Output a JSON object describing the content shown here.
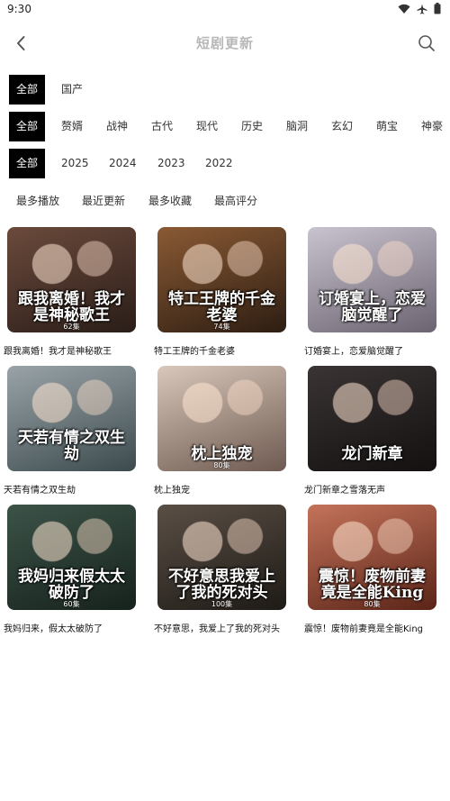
{
  "status": {
    "time": "9:30"
  },
  "header": {
    "title": "短剧更新"
  },
  "filters": {
    "region": [
      "全部",
      "国产"
    ],
    "genre": [
      "全部",
      "赘婿",
      "战神",
      "古代",
      "现代",
      "历史",
      "脑洞",
      "玄幻",
      "萌宝",
      "神豪"
    ],
    "year": [
      "全部",
      "2025",
      "2024",
      "2023",
      "2022"
    ]
  },
  "sort": [
    "最多播放",
    "最近更新",
    "最多收藏",
    "最高评分"
  ],
  "dramas": [
    {
      "title": "跟我离婚！我才是神秘歌王",
      "poster_text": "跟我离婚！我才是神秘歌王",
      "episodes": "62集",
      "colors": [
        "#6b4a3c",
        "#2a1d18"
      ]
    },
    {
      "title": "特工王牌的千金老婆",
      "poster_text": "特工王牌的千金老婆",
      "episodes": "74集",
      "colors": [
        "#8a5a34",
        "#2d1d12"
      ]
    },
    {
      "title": "订婚宴上，恋爱脑觉醒了",
      "poster_text": "订婚宴上，恋爱脑觉醒了",
      "episodes": "",
      "colors": [
        "#c9c3cf",
        "#6b6470"
      ]
    },
    {
      "title": "天若有情之双生劫",
      "poster_text": "天若有情之双生劫",
      "episodes": "",
      "colors": [
        "#9aa4a8",
        "#3c4a4e"
      ]
    },
    {
      "title": "枕上独宠",
      "poster_text": "枕上独宠",
      "episodes": "80集",
      "colors": [
        "#d9c7bb",
        "#6e5a50"
      ]
    },
    {
      "title": "龙门新章之雪落无声",
      "poster_text": "龙门新章",
      "episodes": "",
      "colors": [
        "#3a3434",
        "#141010"
      ]
    },
    {
      "title": "我妈归来，假太太破防了",
      "poster_text": "我妈归来假太太破防了",
      "episodes": "60集",
      "colors": [
        "#3c5348",
        "#16221c"
      ]
    },
    {
      "title": "不好意思，我爱上了我的死对头",
      "poster_text": "不好意思我爱上了我的死对头",
      "episodes": "100集",
      "colors": [
        "#5a4f45",
        "#1e1a16"
      ]
    },
    {
      "title": "震惊！废物前妻竟是全能King",
      "poster_text": "震惊！废物前妻竟是全能King",
      "episodes": "80集",
      "colors": [
        "#c4735a",
        "#5a2418"
      ]
    }
  ]
}
